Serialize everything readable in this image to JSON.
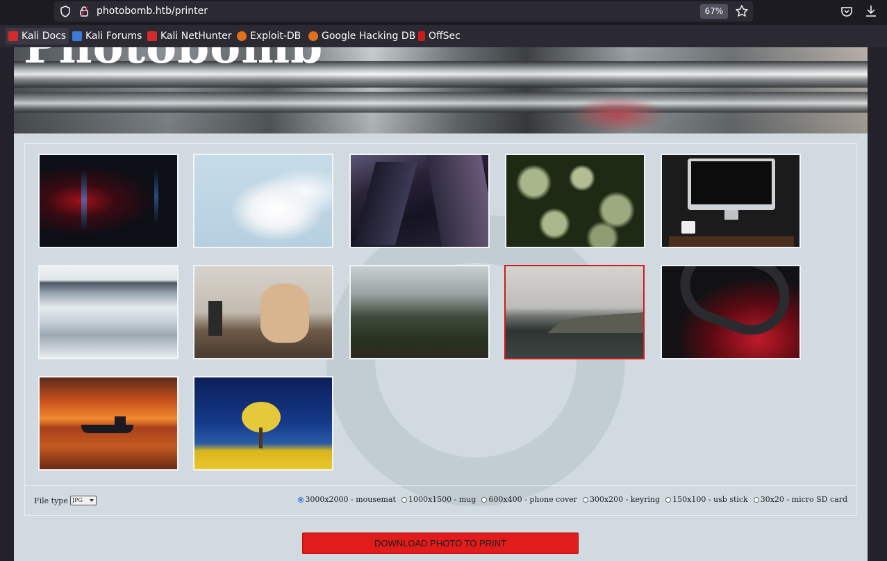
{
  "browser": {
    "url": "photobomb.htb/printer",
    "zoom": "67%",
    "bookmarks": [
      {
        "label": "Kali Docs",
        "color": "#d12b2b"
      },
      {
        "label": "Kali Forums",
        "color": "#3a7bd5"
      },
      {
        "label": "Kali NetHunter",
        "color": "#d12b2b"
      },
      {
        "label": "Exploit-DB",
        "color": "#e0701c"
      },
      {
        "label": "Google Hacking DB",
        "color": "#e0701c"
      },
      {
        "label": "OffSec",
        "color": "#c81e1e"
      }
    ]
  },
  "site": {
    "title": "Photobomb"
  },
  "gallery": {
    "photos": [
      {
        "name": "dark-red-blue-lights",
        "selected": false
      },
      {
        "name": "white-magnolia-blossoms",
        "selected": false
      },
      {
        "name": "skyscrapers-night",
        "selected": false
      },
      {
        "name": "green-succulent-plants",
        "selected": false
      },
      {
        "name": "computer-desk",
        "selected": false
      },
      {
        "name": "icy-waterfall",
        "selected": false
      },
      {
        "name": "woodworking-guitar-bodies",
        "selected": false
      },
      {
        "name": "greenhouse-palms",
        "selected": false
      },
      {
        "name": "misty-coastline",
        "selected": true
      },
      {
        "name": "red-black-abstract-curves",
        "selected": false
      },
      {
        "name": "boat-at-sunset",
        "selected": false
      },
      {
        "name": "yellow-tree-blue-sky",
        "selected": false
      }
    ]
  },
  "options": {
    "file_type_label": "File type",
    "file_type_value": "JPG",
    "dimensions": [
      {
        "label": "3000x2000 - mousemat",
        "checked": true
      },
      {
        "label": "1000x1500 - mug",
        "checked": false
      },
      {
        "label": "600x400 - phone cover",
        "checked": false
      },
      {
        "label": "300x200 - keyring",
        "checked": false
      },
      {
        "label": "150x100 - usb stick",
        "checked": false
      },
      {
        "label": "30x20 - micro SD card",
        "checked": false
      }
    ]
  },
  "download_button": "DOWNLOAD PHOTO TO PRINT"
}
